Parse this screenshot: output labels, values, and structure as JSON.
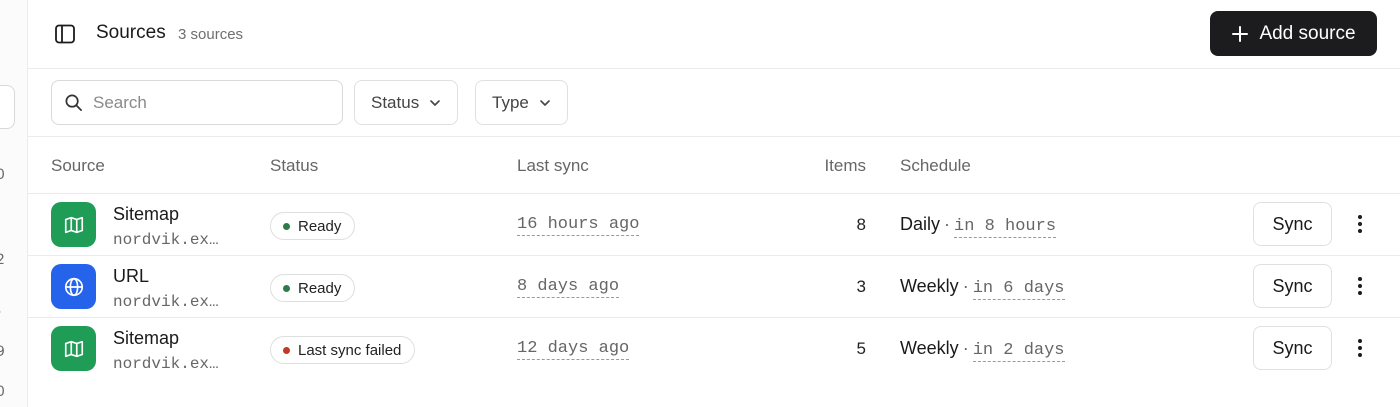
{
  "rail": {
    "numbers": [
      "0",
      "2",
      "-",
      "9",
      "0"
    ]
  },
  "header": {
    "title": "Sources",
    "count": "3 sources",
    "add_label": "Add source"
  },
  "toolbar": {
    "search_placeholder": "Search",
    "filters": [
      {
        "label": "Status"
      },
      {
        "label": "Type"
      }
    ]
  },
  "table": {
    "columns": {
      "source": "Source",
      "status": "Status",
      "last_sync": "Last sync",
      "items": "Items",
      "schedule": "Schedule"
    },
    "rows": [
      {
        "name": "Sitemap",
        "url": "nordvik.ex…",
        "icon": "map-icon",
        "status": "Ready",
        "last_sync": "16 hours ago",
        "items": "8",
        "schedule": "Daily",
        "schedule_sep": "·",
        "next_run": "in 8 hours",
        "sync_label": "Sync"
      },
      {
        "name": "URL",
        "url": "nordvik.ex…",
        "icon": "globe-icon",
        "status": "Ready",
        "last_sync": "8 days ago",
        "items": "3",
        "schedule": "Weekly",
        "schedule_sep": "·",
        "next_run": "in 6 days",
        "sync_label": "Sync"
      },
      {
        "name": "Sitemap",
        "url": "nordvik.ex…",
        "icon": "map-icon",
        "status": "Last sync failed",
        "last_sync": "12 days ago",
        "items": "5",
        "schedule": "Weekly",
        "schedule_sep": "·",
        "next_run": "in 2 days",
        "sync_label": "Sync"
      }
    ]
  },
  "colors": {
    "sitemap_icon_bg": "#1f9d57",
    "url_icon_bg": "#2563eb",
    "ready_dot": "#2f7a4a",
    "failed_dot": "#c0392b",
    "primary_button": "#1c1c1e"
  }
}
